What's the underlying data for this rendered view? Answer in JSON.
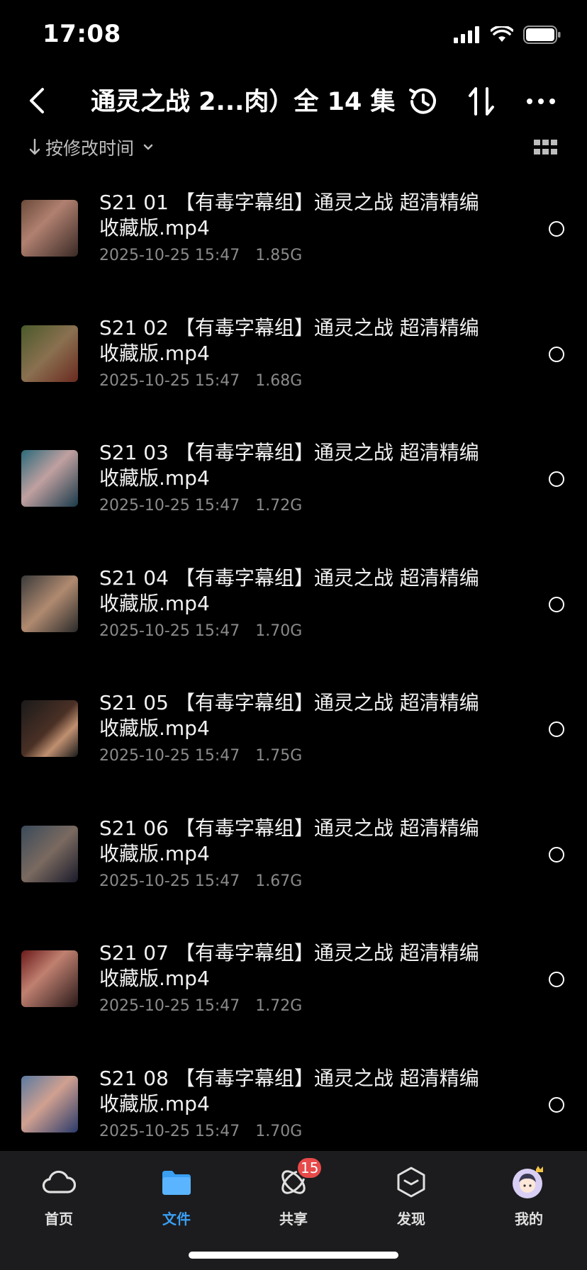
{
  "status": {
    "time": "17:08"
  },
  "header": {
    "title": "通灵之战 2...肉）全 14 集"
  },
  "sort": {
    "label": "按修改时间"
  },
  "files": [
    {
      "name": "S21 01 【有毒字幕组】通灵之战 超清精编收藏版.mp4",
      "date": "2025-10-25 15:47",
      "size": "1.85G"
    },
    {
      "name": "S21 02 【有毒字幕组】通灵之战 超清精编收藏版.mp4",
      "date": "2025-10-25 15:47",
      "size": "1.68G"
    },
    {
      "name": "S21 03 【有毒字幕组】通灵之战 超清精编收藏版.mp4",
      "date": "2025-10-25 15:47",
      "size": "1.72G"
    },
    {
      "name": "S21 04 【有毒字幕组】通灵之战 超清精编收藏版.mp4",
      "date": "2025-10-25 15:47",
      "size": "1.70G"
    },
    {
      "name": "S21 05 【有毒字幕组】通灵之战 超清精编收藏版.mp4",
      "date": "2025-10-25 15:47",
      "size": "1.75G"
    },
    {
      "name": "S21 06 【有毒字幕组】通灵之战 超清精编收藏版.mp4",
      "date": "2025-10-25 15:47",
      "size": "1.67G"
    },
    {
      "name": "S21 07 【有毒字幕组】通灵之战 超清精编收藏版.mp4",
      "date": "2025-10-25 15:47",
      "size": "1.72G"
    },
    {
      "name": "S21 08 【有毒字幕组】通灵之战 超清精编收藏版.mp4",
      "date": "2025-10-25 15:47",
      "size": "1.70G"
    }
  ],
  "tabs": [
    {
      "label": "首页",
      "icon": "cloud-icon"
    },
    {
      "label": "文件",
      "icon": "folder-icon"
    },
    {
      "label": "共享",
      "icon": "share-icon",
      "badge": "15"
    },
    {
      "label": "发现",
      "icon": "discover-icon"
    },
    {
      "label": "我的",
      "icon": "avatar-icon"
    }
  ],
  "colors": {
    "accent": "#3a9ff3",
    "badge": "#e84a4a",
    "tab_bar_bg": "#1c1c1e"
  }
}
